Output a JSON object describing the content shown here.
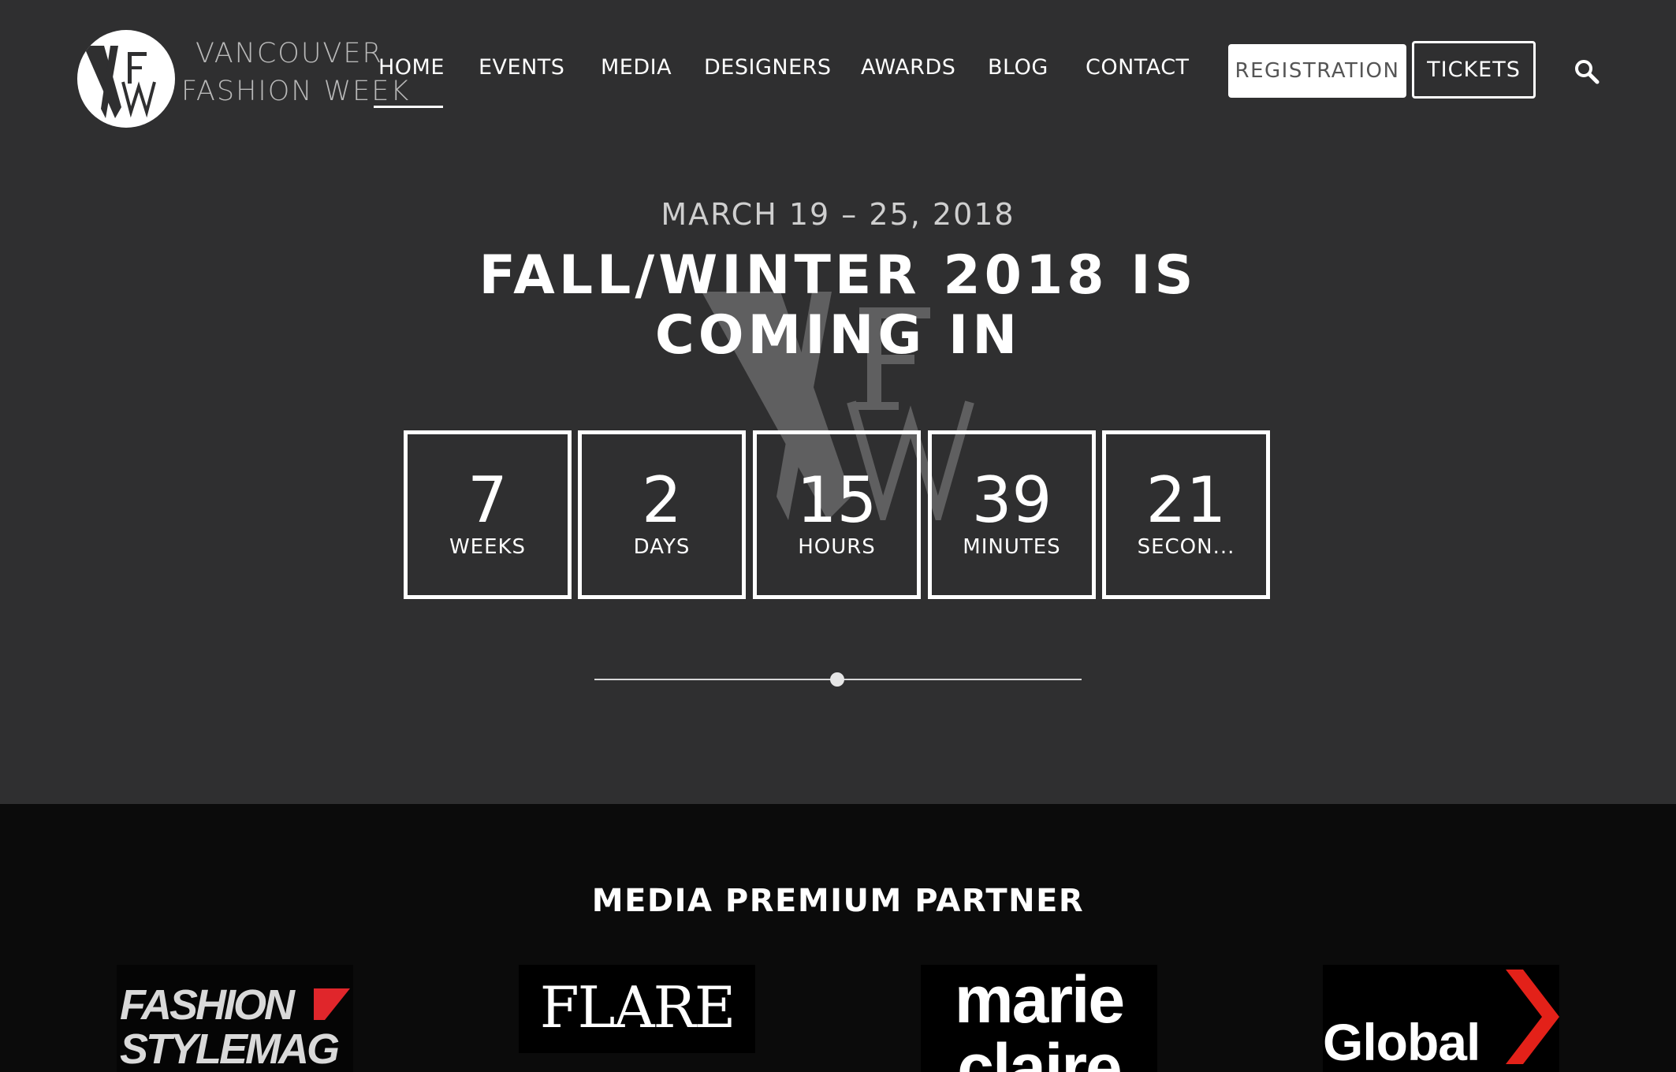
{
  "brand": {
    "line1": "VANCOUVER",
    "line2": "FASHION WEEK",
    "monogram": "VFW"
  },
  "nav": {
    "items": [
      {
        "label": "HOME",
        "active": true
      },
      {
        "label": "EVENTS"
      },
      {
        "label": "MEDIA"
      },
      {
        "label": "DESIGNERS"
      },
      {
        "label": "AWARDS"
      },
      {
        "label": "BLOG"
      },
      {
        "label": "CONTACT"
      }
    ],
    "registration_label": "REGISTRATION",
    "tickets_label": "TICKETS",
    "search_icon": "search-icon"
  },
  "hero": {
    "date": "MARCH 19 – 25, 2018",
    "title": "FALL/WINTER 2018 IS COMING IN",
    "countdown": [
      {
        "value": "7",
        "unit": "WEEKS"
      },
      {
        "value": "2",
        "unit": "DAYS"
      },
      {
        "value": "15",
        "unit": "HOURS"
      },
      {
        "value": "39",
        "unit": "MINUTES"
      },
      {
        "value": "21",
        "unit": "SECON..."
      }
    ]
  },
  "partners": {
    "title": "MEDIA PREMIUM PARTNER",
    "logos": [
      {
        "name": "FASHION STYLEMAG",
        "line1": "FASHION",
        "line2": "STYLEMAG"
      },
      {
        "name": "FLARE",
        "text": "FLARE"
      },
      {
        "name": "marie claire",
        "line1": "marie",
        "line2": "claire"
      },
      {
        "name": "Global",
        "text": "Global"
      }
    ]
  },
  "colors": {
    "hero_bg": "#2f2f30",
    "partners_bg": "#0b0b0b",
    "text": "#ffffff",
    "global_accent": "#e32119",
    "fsm_accent": "#e0262b"
  }
}
